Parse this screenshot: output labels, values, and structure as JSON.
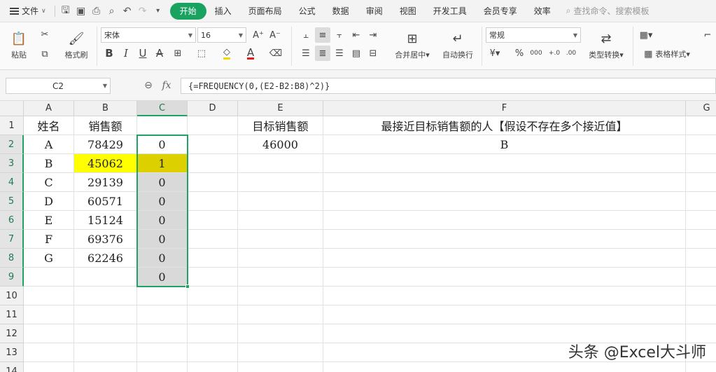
{
  "menubar": {
    "file_label": "文件",
    "tabs": [
      {
        "label": "开始",
        "active": true
      },
      {
        "label": "插入"
      },
      {
        "label": "页面布局"
      },
      {
        "label": "公式"
      },
      {
        "label": "数据"
      },
      {
        "label": "审阅"
      },
      {
        "label": "视图"
      },
      {
        "label": "开发工具"
      },
      {
        "label": "会员专享"
      },
      {
        "label": "效率"
      }
    ],
    "search_placeholder": "查找命令、搜索模板"
  },
  "ribbon": {
    "paste_label": "粘贴",
    "format_painter_label": "格式刷",
    "font_name": "宋体",
    "font_size": "16",
    "merge_center_label": "合并居中",
    "wrap_text_label": "自动换行",
    "number_format": "常规",
    "type_convert_label": "类型转换",
    "table_style_label": "表格样式",
    "font_color": "#e02020",
    "fill_color": "#f5d800"
  },
  "formula_bar": {
    "name_box": "C2",
    "fx_label": "fx",
    "formula": "{=FREQUENCY(0,(E2-B2:B8)^2)}"
  },
  "sheet": {
    "columns": [
      "A",
      "B",
      "C",
      "D",
      "E",
      "F",
      "G"
    ],
    "rows": [
      "1",
      "2",
      "3",
      "4",
      "5",
      "6",
      "7",
      "8",
      "9",
      "10",
      "11",
      "12",
      "13",
      "14"
    ],
    "selected_column": "C",
    "cells": {
      "A1": "姓名",
      "B1": "销售额",
      "E1": "目标销售额",
      "F1": "最接近目标销售额的人【假设不存在多个接近值】",
      "A2": "A",
      "B2": "78429",
      "C2": "0",
      "E2": "46000",
      "F2": "B",
      "A3": "B",
      "B3": "45062",
      "C3": "1",
      "A4": "C",
      "B4": "29139",
      "C4": "0",
      "A5": "D",
      "B5": "60571",
      "C5": "0",
      "A6": "E",
      "B6": "15124",
      "C6": "0",
      "A7": "F",
      "B7": "69376",
      "C7": "0",
      "A8": "G",
      "B8": "62246",
      "C8": "0",
      "C9": "0"
    },
    "highlight_colors": {
      "B3": "#ffff00",
      "C3": "#dcd000",
      "C_range": "#d9d9d9"
    }
  },
  "watermark": "头条 @Excel大斗师"
}
